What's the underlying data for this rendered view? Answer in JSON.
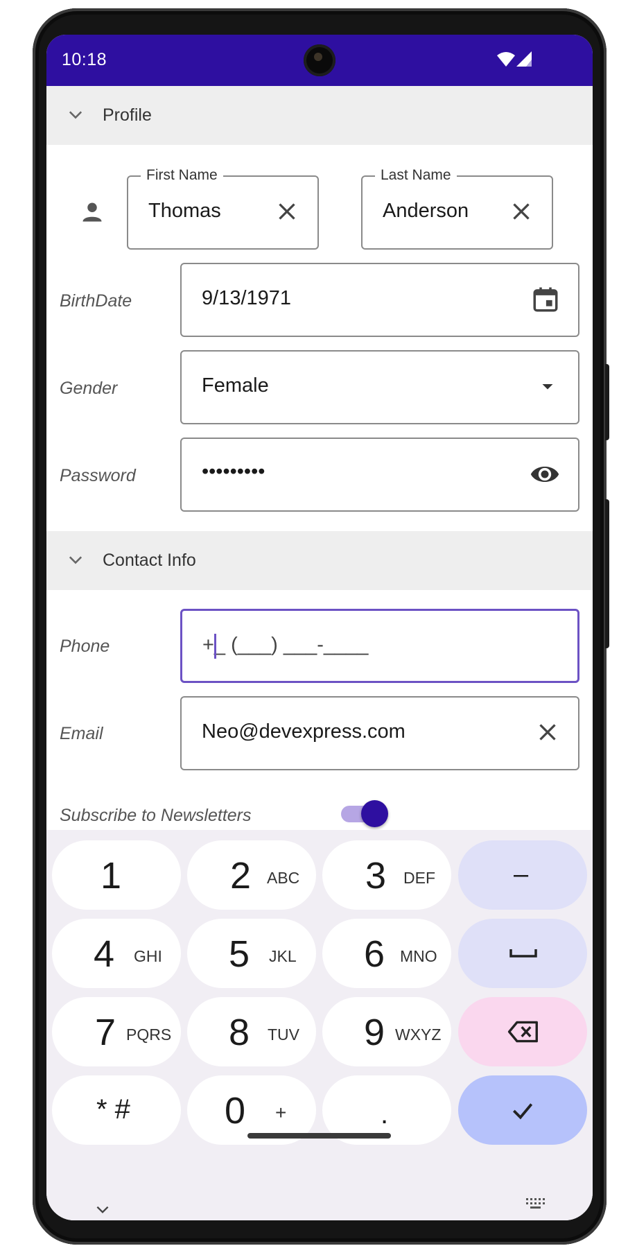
{
  "status_bar": {
    "time": "10:18",
    "bg_color": "#2e0fa0",
    "icons": [
      "wifi-icon",
      "signal-icon"
    ]
  },
  "profile_group": {
    "title": "Profile",
    "first_name": {
      "label": "First Name",
      "value": "Thomas"
    },
    "last_name": {
      "label": "Last Name",
      "value": "Anderson"
    },
    "birthdate": {
      "label": "BirthDate",
      "value": "9/13/1971"
    },
    "gender": {
      "label": "Gender",
      "value": "Female"
    },
    "password": {
      "label": "Password",
      "value": "•••••••••"
    }
  },
  "contact_group": {
    "title": "Contact Info",
    "phone": {
      "label": "Phone",
      "value": "+_ (___) ___-____"
    },
    "email": {
      "label": "Email",
      "value": "Neo@devexpress.com"
    },
    "newsletter": {
      "label": "Subscribe to Newsletters",
      "checked": true
    }
  },
  "keyboard": {
    "keys": [
      {
        "num": "1",
        "letters": ""
      },
      {
        "num": "2",
        "letters": "ABC"
      },
      {
        "num": "3",
        "letters": "DEF"
      },
      {
        "num": "4",
        "letters": "GHI"
      },
      {
        "num": "5",
        "letters": "JKL"
      },
      {
        "num": "6",
        "letters": "MNO"
      },
      {
        "num": "7",
        "letters": "PQRS"
      },
      {
        "num": "8",
        "letters": "TUV"
      },
      {
        "num": "9",
        "letters": "WXYZ"
      },
      {
        "num": "* #",
        "letters": ""
      },
      {
        "num": "0",
        "letters": "+"
      },
      {
        "num": ".",
        "letters": ""
      }
    ],
    "minus": "–",
    "accent_color": "#2e0fa0",
    "focus_color": "#6c52c4"
  }
}
